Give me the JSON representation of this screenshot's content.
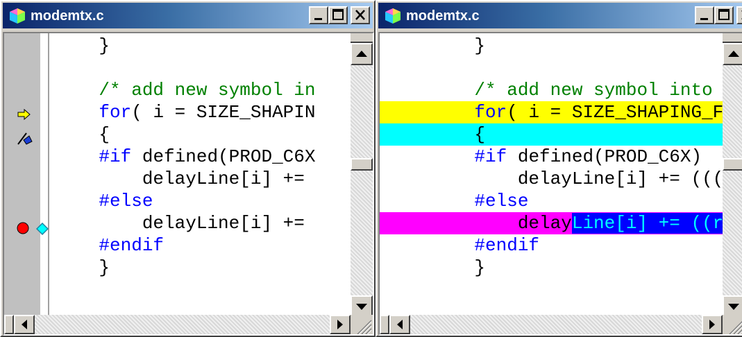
{
  "windows": [
    {
      "title": "modemtx.c",
      "lines": [
        {
          "indent": "    ",
          "parts": [
            {
              "t": "}",
              "c": "plain"
            }
          ]
        },
        {
          "indent": "",
          "parts": []
        },
        {
          "indent": "    ",
          "parts": [
            {
              "t": "/* add new symbol in",
              "c": "cm"
            }
          ]
        },
        {
          "indent": "    ",
          "parts": [
            {
              "t": "for",
              "c": "kw"
            },
            {
              "t": "( i = SIZE_SHAPIN",
              "c": "plain"
            }
          ]
        },
        {
          "indent": "    ",
          "parts": [
            {
              "t": "{",
              "c": "plain"
            }
          ]
        },
        {
          "indent": "    ",
          "parts": [
            {
              "t": "#if",
              "c": "pp"
            },
            {
              "t": " defined(PROD_C6X",
              "c": "plain"
            }
          ]
        },
        {
          "indent": "        ",
          "parts": [
            {
              "t": "delayLine[i] +=",
              "c": "plain"
            }
          ]
        },
        {
          "indent": "    ",
          "parts": [
            {
              "t": "#else",
              "c": "pp"
            }
          ]
        },
        {
          "indent": "        ",
          "parts": [
            {
              "t": "delayLine[i] +=",
              "c": "plain"
            }
          ]
        },
        {
          "indent": "    ",
          "parts": [
            {
              "t": "#endif",
              "c": "pp"
            }
          ]
        },
        {
          "indent": "    ",
          "parts": [
            {
              "t": "}",
              "c": "plain"
            }
          ]
        },
        {
          "indent": "",
          "parts": []
        }
      ]
    },
    {
      "title": "modemtx.c",
      "lines": [
        {
          "indent": "    ",
          "parts": [
            {
              "t": "}",
              "c": "plain"
            }
          ]
        },
        {
          "indent": "",
          "parts": []
        },
        {
          "indent": "    ",
          "parts": [
            {
              "t": "/* add new symbol into",
              "c": "cm"
            }
          ]
        },
        {
          "indent": "    ",
          "parts": [
            {
              "t": "for",
              "c": "kw"
            },
            {
              "t": "( i = SIZE_SHAPING_F",
              "c": "plain"
            }
          ],
          "highlight": "yellow"
        },
        {
          "indent": "    ",
          "parts": [
            {
              "t": "{",
              "c": "plain"
            }
          ],
          "highlight": "cyan"
        },
        {
          "indent": "    ",
          "parts": [
            {
              "t": "#if",
              "c": "pp"
            },
            {
              "t": " defined(PROD_C6X)",
              "c": "plain"
            }
          ]
        },
        {
          "indent": "        ",
          "parts": [
            {
              "t": "delayLine[i] += (((",
              "c": "plain"
            }
          ]
        },
        {
          "indent": "    ",
          "parts": [
            {
              "t": "#else",
              "c": "pp"
            }
          ]
        },
        {
          "indent": "        ",
          "parts": [
            {
              "t": "delay",
              "c": "plain"
            },
            {
              "t": "Line[i] += ((r",
              "c": "blue"
            }
          ],
          "highlight": "magenta"
        },
        {
          "indent": "    ",
          "parts": [
            {
              "t": "#endif",
              "c": "pp"
            }
          ]
        },
        {
          "indent": "    ",
          "parts": [
            {
              "t": "}",
              "c": "plain"
            }
          ]
        },
        {
          "indent": "",
          "parts": []
        }
      ]
    }
  ],
  "gutter_markers": [
    "pc-arrow-icon",
    "bookmark-icon",
    "breakpoint-icon",
    "probe-point-icon"
  ],
  "colors": {
    "titlebar_start": "#0a246a",
    "titlebar_end": "#a6caf0",
    "pc_highlight": "#ffff00",
    "block_highlight": "#00ffff",
    "breakpoint_highlight": "#ff00ff",
    "selection": "#0000ff"
  }
}
